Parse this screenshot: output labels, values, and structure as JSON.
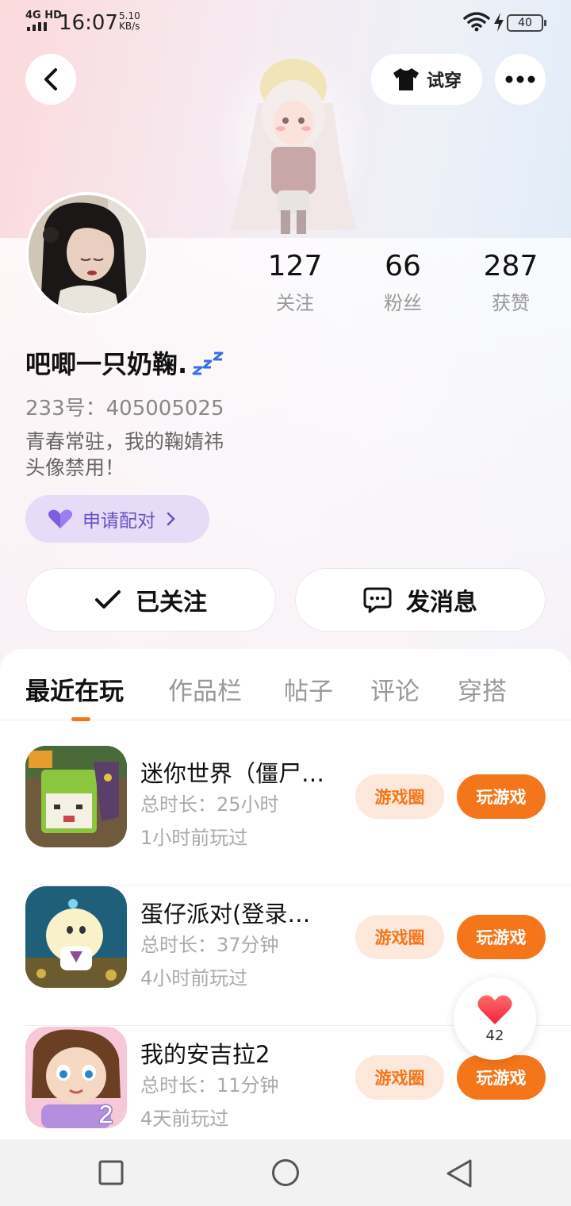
{
  "status_bar": {
    "network": "4G HD",
    "time": "16:07",
    "speed_value": "5.10",
    "speed_unit": "KB/s",
    "battery": "40"
  },
  "header": {
    "try_on_label": "试穿"
  },
  "profile": {
    "stats": [
      {
        "value": "127",
        "label": "关注"
      },
      {
        "value": "66",
        "label": "粉丝"
      },
      {
        "value": "287",
        "label": "获赞"
      }
    ],
    "nickname": "吧唧一只奶鞠.",
    "id_line": "233号：405005025",
    "bio_line1": "青春常驻，我的鞠婧祎",
    "bio_line2": "头像禁用！",
    "pair_label": "申请配对",
    "follow_label": "已关注",
    "message_label": "发消息"
  },
  "tabs": [
    {
      "label": "最近在玩",
      "active": true
    },
    {
      "label": "作品栏",
      "active": false
    },
    {
      "label": "帖子",
      "active": false
    },
    {
      "label": "评论",
      "active": false
    },
    {
      "label": "穿搭",
      "active": false
    }
  ],
  "games": [
    {
      "title": "迷你世界（僵尸…",
      "duration": "总时长：25小时",
      "last_played": "1小时前玩过",
      "circle_label": "游戏圈",
      "play_label": "玩游戏"
    },
    {
      "title": "蛋仔派对(登录…",
      "duration": "总时长：37分钟",
      "last_played": "4小时前玩过",
      "circle_label": "游戏圈",
      "play_label": "玩游戏"
    },
    {
      "title": "我的安吉拉2",
      "duration": "总时长：11分钟",
      "last_played": "4天前玩过",
      "circle_label": "游戏圈",
      "play_label": "玩游戏"
    }
  ],
  "float_like": {
    "count": "42"
  },
  "colors": {
    "accent": "#f5761a",
    "accent_light": "#fde8dc",
    "pair_bg": "#e7dbf7",
    "pair_text": "#6a4fc4"
  },
  "icons": [
    "back-arrow-icon",
    "tshirt-icon",
    "more-dots-icon",
    "heart-icon",
    "chevron-right-icon",
    "check-icon",
    "chat-bubble-icon",
    "square-nav-icon",
    "circle-nav-icon",
    "triangle-back-nav-icon"
  ]
}
